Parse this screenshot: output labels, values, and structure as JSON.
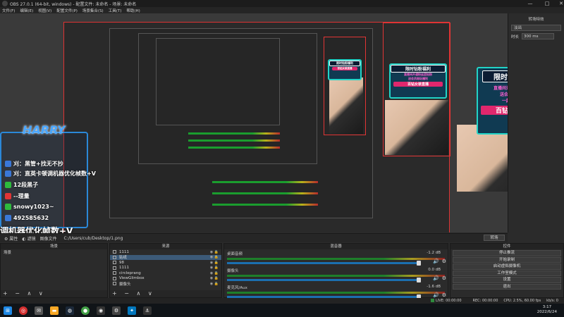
{
  "window": {
    "title": "OBS 27.0.1 (64-bit, windows) - 配置文件: 未命名 - 场景: 未命名",
    "controls": [
      "—",
      "□",
      "✕"
    ]
  },
  "menu": [
    "文件(F)",
    "编辑(E)",
    "视图(V)",
    "配置文件(P)",
    "场景集合(S)",
    "工具(T)",
    "帮助(H)"
  ],
  "overlay": {
    "brand": "HARRY",
    "lines": [
      {
        "text": "刈：黑管+找无不抄",
        "icon": "qq-icon",
        "color": "#3a78d8"
      },
      {
        "text": "刈：直英卡顿调机器优化帧数+V",
        "icon": "qq-icon",
        "color": "#3a78d8"
      },
      {
        "text": "12段黑子",
        "icon": "wechat-icon",
        "color": "#2dbb3d"
      },
      {
        "text": "--理量",
        "icon": "weibo-icon",
        "color": "#e23535"
      },
      {
        "text": "snowy1023~",
        "icon": "wechat-icon",
        "color": "#2dbb3d"
      },
      {
        "text": "492585632",
        "icon": "qq-icon",
        "color": "#3a78d8"
      }
    ],
    "caption": "调机器优化帧数+V"
  },
  "promo": {
    "header": "限时钻粉福利",
    "line1": "直播间开通粉丝团钻粉",
    "line2": "送会员陪玩福利",
    "line3": "一起开黑上分",
    "banner": "百钻女装直播"
  },
  "right_panel": {
    "title": "转场特效",
    "transition": "淡出",
    "duration_label": "时长",
    "duration_value": "300 ms"
  },
  "source_toolbar": {
    "properties": "属性",
    "filters": "滤镜",
    "image_file": "图像文件",
    "path": "C:/Users/cub/Desktop/1.png"
  },
  "studio_mode_button": "转场",
  "scenes": {
    "title": "场景",
    "items": [
      "场景"
    ]
  },
  "sources": {
    "title": "来源",
    "items": [
      "1111",
      "贴纸",
      "98",
      "1111",
      "circleprang",
      "ViewGlimbox",
      "摄像头"
    ]
  },
  "mixer": {
    "title": "混音器",
    "channels": [
      {
        "name": "桌面音频",
        "db": "-1.2 dB"
      },
      {
        "name": "摄像头",
        "db": "0.0 dB"
      },
      {
        "name": "麦克风/Aux",
        "db": "-1.6 dB"
      }
    ]
  },
  "controls": {
    "title": "控件",
    "buttons": [
      "停止推流",
      "开始录制",
      "启动虚拟摄像机",
      "工作室模式",
      "设置",
      "退出"
    ]
  },
  "dock_footer": "+ − ∧ ∨",
  "status": {
    "live": "LIVE: 00:00:00",
    "rec": "REC: 00:00:00",
    "cpu": "CPU: 2.5%, 60.00 fps",
    "kb": "kb/s: 0"
  },
  "taskbar": {
    "time": "3:17",
    "date": "2022/6/24"
  },
  "colors": {
    "accent": "#1b6fb0",
    "selection": "#3c5a78",
    "preview_border": "#e23535"
  }
}
